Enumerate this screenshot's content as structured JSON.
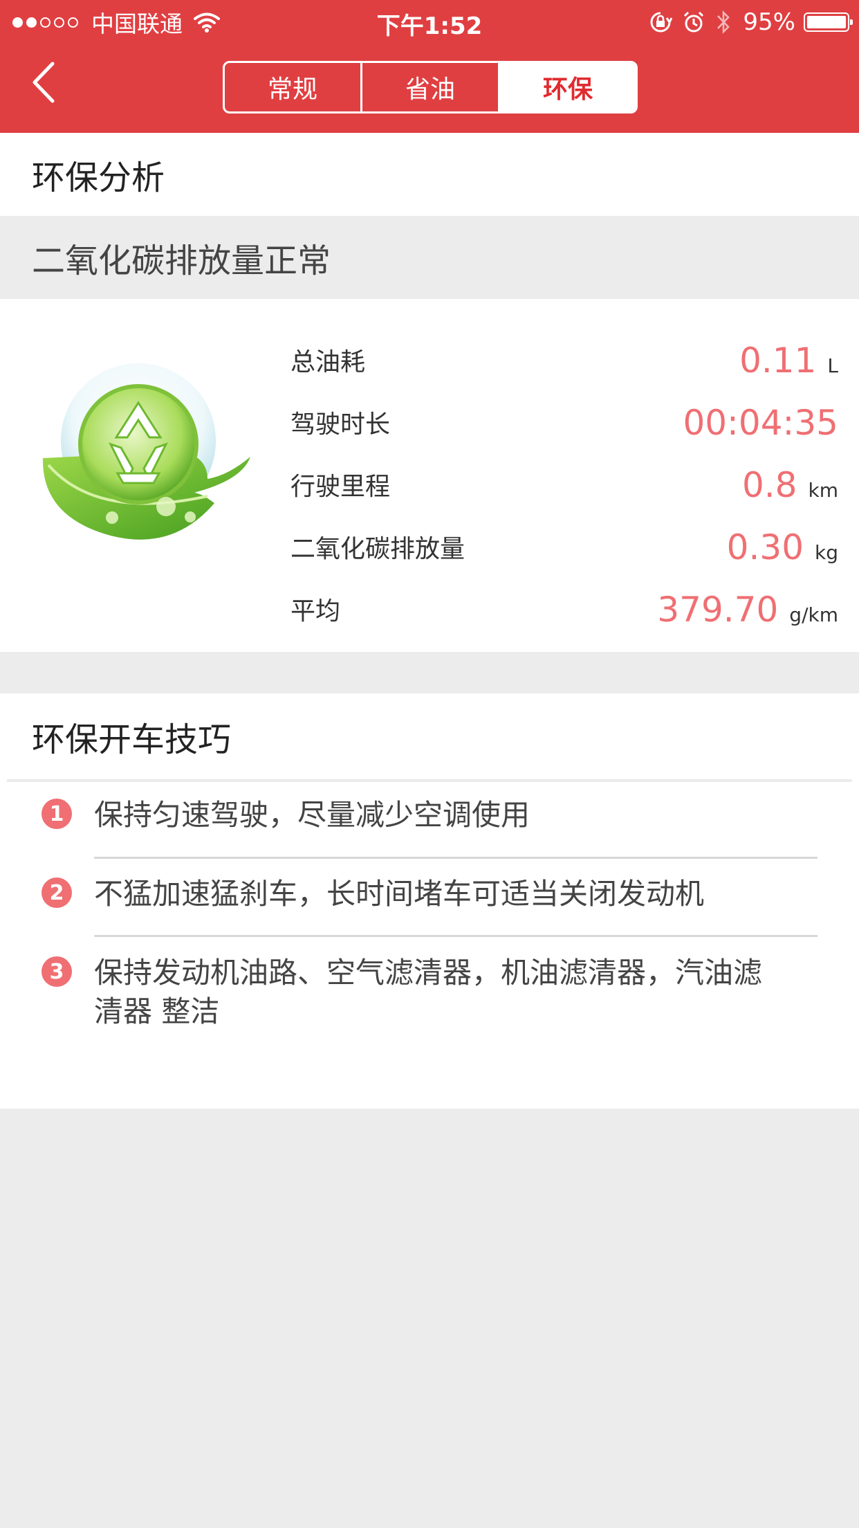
{
  "status_bar": {
    "carrier": "中国联通",
    "time": "下午1:52",
    "battery": "95%",
    "battery_level": 0.95,
    "signal_bars": 2
  },
  "nav": {
    "tabs": [
      {
        "label": "常规",
        "active": false
      },
      {
        "label": "省油",
        "active": false
      },
      {
        "label": "环保",
        "active": true
      }
    ]
  },
  "analysis": {
    "title": "环保分析",
    "status": "二氧化碳排放量正常",
    "stats": [
      {
        "label": "总油耗",
        "value": "0.11",
        "unit": "L"
      },
      {
        "label": "驾驶时长",
        "value": "00:04:35",
        "unit": ""
      },
      {
        "label": "行驶里程",
        "value": "0.8",
        "unit": "km"
      },
      {
        "label": "二氧化碳排放量",
        "value": "0.30",
        "unit": "kg"
      },
      {
        "label": "平均",
        "value": "379.70",
        "unit": "g/km"
      }
    ]
  },
  "tips": {
    "title": "环保开车技巧",
    "items": [
      {
        "number": "1",
        "text": "保持匀速驾驶，尽量减少空调使用"
      },
      {
        "number": "2",
        "text": "不猛加速猛刹车，长时间堵车可适当关闭发动机"
      },
      {
        "number": "3",
        "text": "保持发动机油路、空气滤清器，机油滤清器，汽油滤清器 整洁"
      }
    ]
  },
  "colors": {
    "header_bg": "#e03f42",
    "accent_value": "#ef6f73",
    "active_tab_text": "#e02b2f",
    "page_bg": "#ececec"
  },
  "icons": [
    "back-chevron-icon",
    "wifi-icon",
    "rotation-lock-icon",
    "alarm-icon",
    "bluetooth-icon",
    "battery-icon",
    "recycle-leaf-icon"
  ]
}
